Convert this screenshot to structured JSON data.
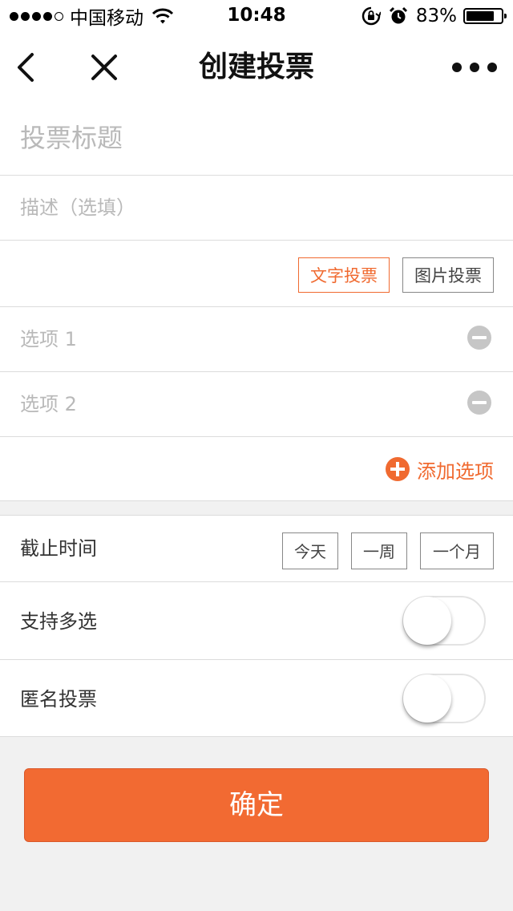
{
  "status_bar": {
    "carrier": "中国移动",
    "time": "10:48",
    "battery_percent": "83%",
    "battery_level": 0.83,
    "signal_dots": 4,
    "icons": [
      "signal-dots-icon",
      "wifi-icon",
      "rotation-lock-icon",
      "alarm-icon",
      "battery-icon"
    ]
  },
  "nav": {
    "title": "创建投票",
    "icons": [
      "back-chevron-icon",
      "close-icon",
      "more-dots-icon"
    ]
  },
  "form": {
    "title_placeholder": "投票标题",
    "description_placeholder": "描述（选填）",
    "vote_types": {
      "text_label": "文字投票",
      "image_label": "图片投票",
      "selected": "text"
    },
    "options": [
      {
        "placeholder": "选项 1"
      },
      {
        "placeholder": "选项 2"
      }
    ],
    "add_option_label": "添加选项"
  },
  "settings": {
    "deadline": {
      "label": "截止时间",
      "choices": [
        "今天",
        "一周",
        "一个月"
      ]
    },
    "multi_select": {
      "label": "支持多选",
      "on": false
    },
    "anonymous": {
      "label": "匿名投票",
      "on": false
    }
  },
  "confirm_label": "确定",
  "colors": {
    "accent": "#f26a32",
    "placeholder": "#b9b9b9",
    "background": "#f1f1f1",
    "divider": "#dcdcdc"
  }
}
